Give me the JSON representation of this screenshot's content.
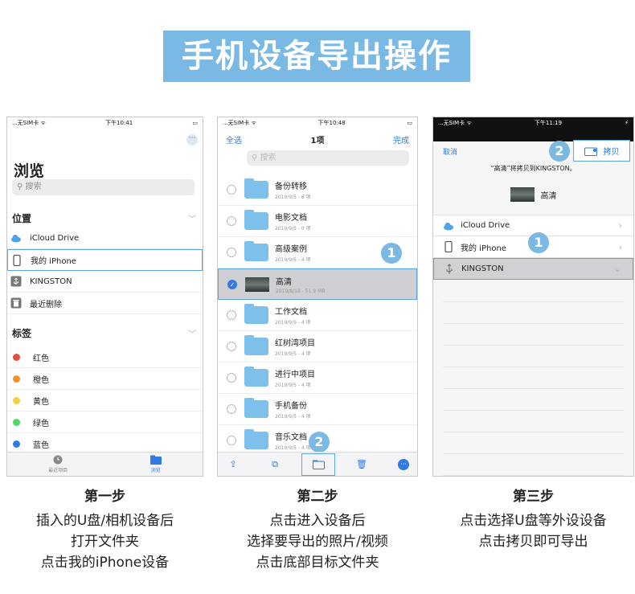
{
  "banner": "手机设备导出操作",
  "p1": {
    "status_left": "...无SIM卡 ᯤ",
    "status_time": "下午10:41",
    "more": "···",
    "title": "浏览",
    "search": "搜索",
    "section_locations": "位置",
    "section_tags": "标签",
    "locations": [
      "iCloud Drive",
      "我的 iPhone",
      "KINGSTON",
      "最近删除"
    ],
    "tags": [
      {
        "label": "红色",
        "color": "#e74c3c"
      },
      {
        "label": "橙色",
        "color": "#f0932b"
      },
      {
        "label": "黄色",
        "color": "#f5d142"
      },
      {
        "label": "绿色",
        "color": "#4cd964"
      },
      {
        "label": "蓝色",
        "color": "#2f7be0"
      }
    ],
    "tab_recent": "最近项目",
    "tab_browse": "浏览"
  },
  "p2": {
    "status_left": "...无SIM卡 ᯤ",
    "status_time": "下午10:48",
    "select_all": "全选",
    "count": "1项",
    "done": "完成",
    "search": "搜索",
    "files": [
      {
        "name": "备份转移",
        "meta": "2019/9/5 - 6 项"
      },
      {
        "name": "电影文档",
        "meta": "2019/9/5 - 0 项"
      },
      {
        "name": "高级案例",
        "meta": "2019/9/5 - 4 项"
      },
      {
        "name": "高清",
        "meta": "2019/8/18 - 51.9 MB"
      },
      {
        "name": "工作文档",
        "meta": "2019/9/9 - 4 项"
      },
      {
        "name": "红树湾项目",
        "meta": "2019/9/5 - 4 项"
      },
      {
        "name": "进行中项目",
        "meta": "2019/9/5 - 4 项"
      },
      {
        "name": "手机备份",
        "meta": "2019/9/5 - 4 项"
      },
      {
        "name": "音乐文档",
        "meta": "2019/9/5 - 4 项"
      }
    ],
    "badge1": "1",
    "badge2": "2"
  },
  "p3": {
    "status_left": "...无SIM卡 ᯤ",
    "status_time": "下午11:19",
    "status_right": "⚡",
    "cancel": "取消",
    "copy": "拷贝",
    "message": "“高清”将拷贝到KINGSTON。",
    "file": "高清",
    "locations": [
      "iCloud Drive",
      "我的 iPhone",
      "KINGSTON"
    ],
    "badge1": "1",
    "badge2": "2"
  },
  "captions": [
    {
      "title": "第一步",
      "lines": [
        "插入的U盘/相机设备后",
        "打开文件夹",
        "点击我的iPhone设备"
      ]
    },
    {
      "title": "第二步",
      "lines": [
        "点击进入设备后",
        "选择要导出的照片/视频",
        "点击底部目标文件夹"
      ]
    },
    {
      "title": "第三步",
      "lines": [
        "点击选择U盘等外设设备",
        "点击拷贝即可导出"
      ]
    }
  ]
}
